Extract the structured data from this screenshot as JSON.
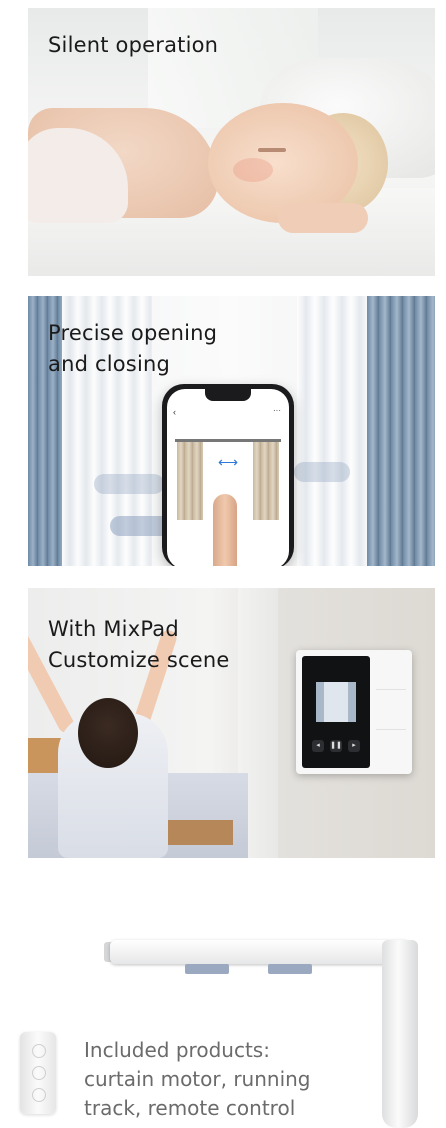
{
  "features": [
    {
      "caption_lines": [
        "Silent operation"
      ]
    },
    {
      "caption_lines": [
        "Precise opening",
        "and closing"
      ]
    },
    {
      "caption_lines": [
        "With MixPad",
        "Customize scene"
      ]
    }
  ],
  "products": {
    "caption_lines": [
      "Included products:",
      "curtain motor, running",
      "track, remote control"
    ]
  }
}
